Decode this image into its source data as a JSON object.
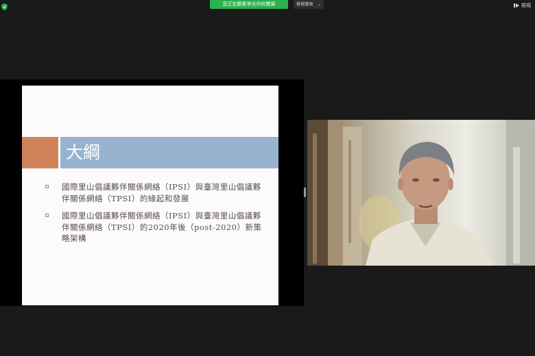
{
  "topbar": {
    "share_banner": "您正在觀看李光中的螢幕",
    "view_options": "檢視選項",
    "view_button": "檢視"
  },
  "slide": {
    "title": "大綱",
    "bullets": [
      "國際里山倡議夥伴關係網絡（IPSI）與臺灣里山倡議夥伴關係網絡（TPSI）的緣起和發展",
      "國際里山倡議夥伴關係網絡（IPSI）與臺灣里山倡議夥伴關係網絡（TPSI）的2020年後（post-2020）新策略架構"
    ],
    "colors": {
      "accent": "#d0835a",
      "title_bar": "#98b3cf",
      "text": "#5a4a48"
    }
  },
  "icons": [
    "shield-icon",
    "chevron-down-icon",
    "view-icon"
  ],
  "colors": {
    "banner": "#2bb14d",
    "background": "#1a1a1a"
  }
}
